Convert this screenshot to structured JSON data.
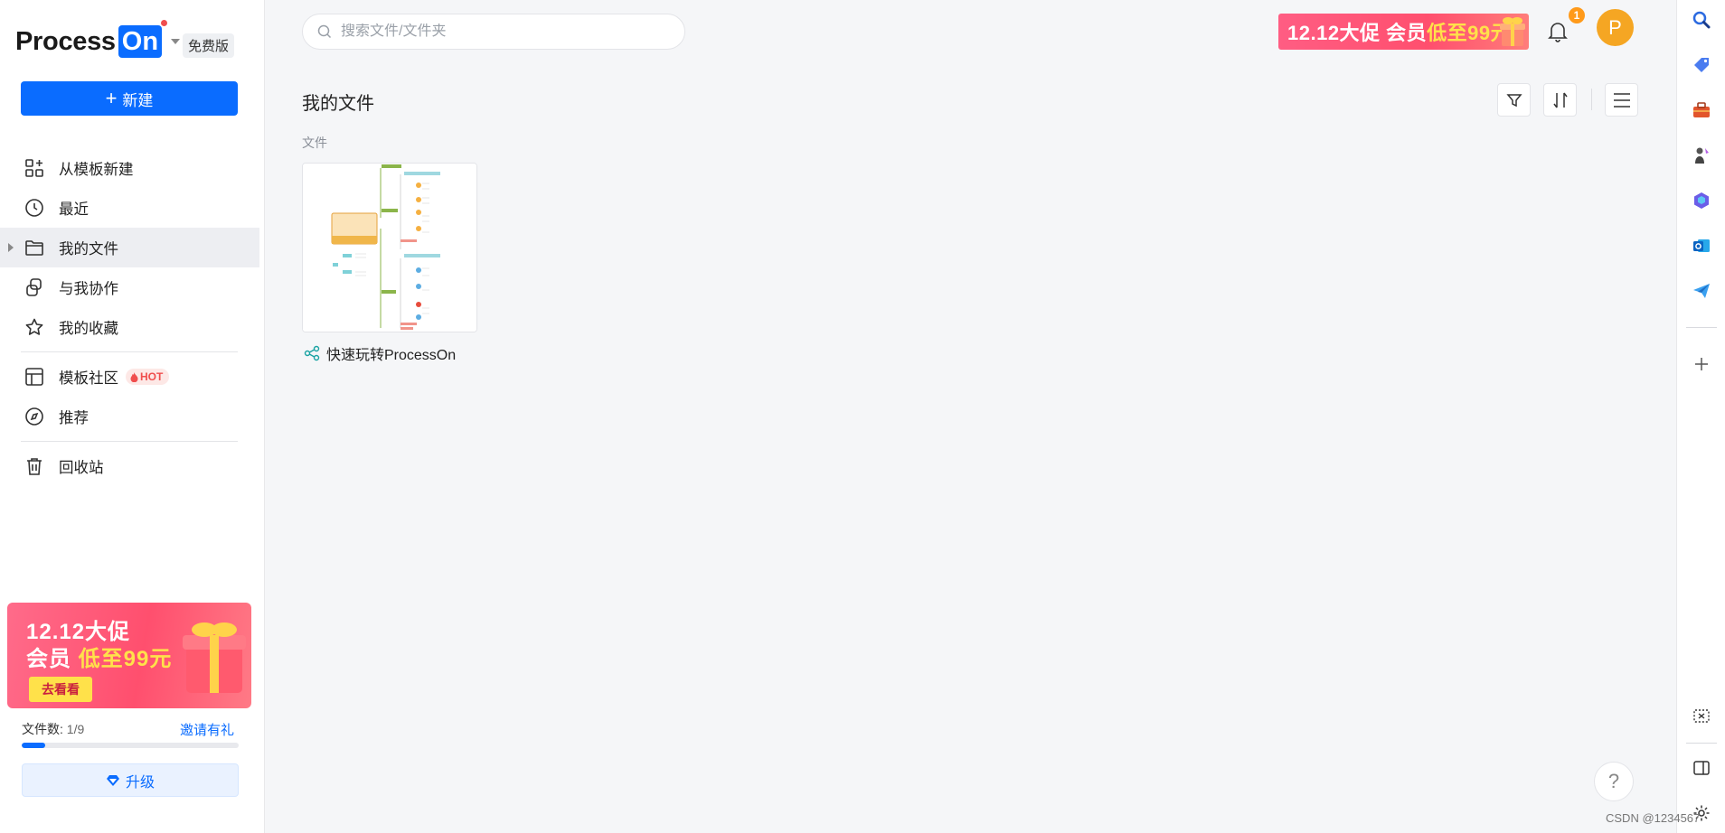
{
  "app": {
    "logo_text": "Process",
    "logo_on": "On",
    "edition": "免费版"
  },
  "sidebar": {
    "new_button": "新建",
    "nav": [
      {
        "label": "从模板新建",
        "icon": "template-grid-icon"
      },
      {
        "label": "最近",
        "icon": "clock-icon"
      },
      {
        "label": "我的文件",
        "icon": "folder-icon",
        "active": true
      },
      {
        "label": "与我协作",
        "icon": "collaborate-icon"
      },
      {
        "label": "我的收藏",
        "icon": "star-icon"
      },
      {
        "label": "模板社区",
        "icon": "layout-icon",
        "badge": "HOT"
      },
      {
        "label": "推荐",
        "icon": "compass-icon"
      },
      {
        "label": "回收站",
        "icon": "trash-icon"
      }
    ],
    "promo": {
      "line1": "12.12大促",
      "line2_prefix": "会员",
      "line2_highlight": "低至99元",
      "button": "去看看"
    },
    "file_count_label": "文件数:",
    "file_count_value": "1/9",
    "file_count_fraction": 0.11,
    "invite": "邀请有礼",
    "upgrade": "升级"
  },
  "header": {
    "search_placeholder": "搜索文件/文件夹",
    "promo_prefix": "12.12大促 会员",
    "promo_highlight": "低至99元",
    "notification_count": "1",
    "avatar_letter": "P"
  },
  "main": {
    "title": "我的文件",
    "section_label": "文件",
    "files": [
      {
        "name": "快速玩转ProcessOn",
        "type_icon": "mindmap-icon"
      }
    ]
  },
  "footer": {
    "help": "?",
    "watermark": "CSDN @1234567"
  },
  "colors": {
    "accent": "#0a6cff",
    "promo": "#ff4f6e",
    "avatar": "#f5a623",
    "badge": "#ff9a1a"
  }
}
